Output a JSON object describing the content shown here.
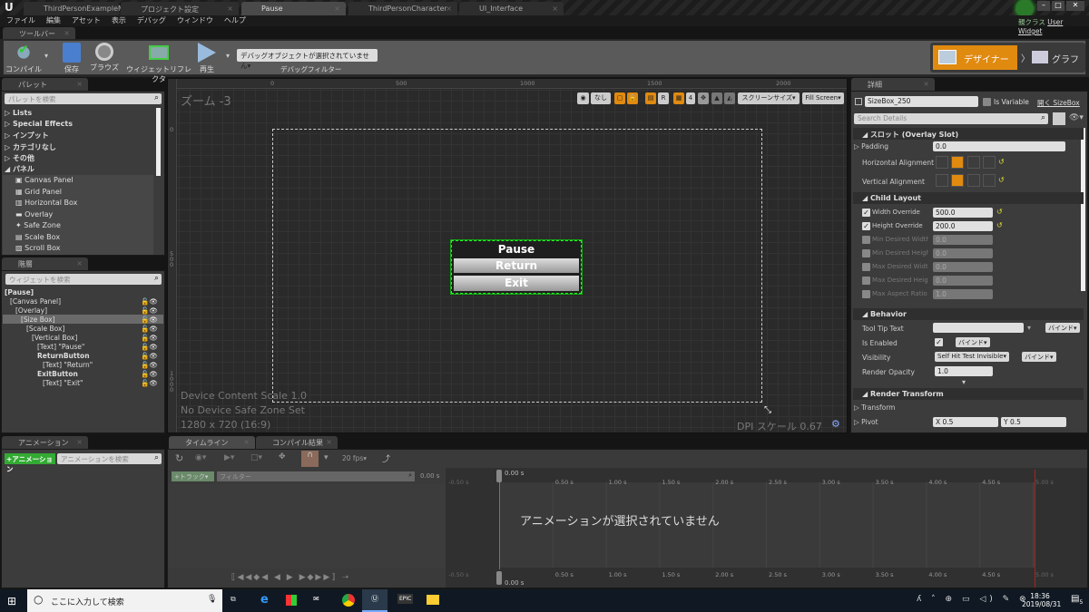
{
  "doc_tabs": [
    {
      "label": "ThirdPersonExampleMap",
      "active": false
    },
    {
      "label": "プロジェクト設定",
      "active": false
    },
    {
      "label": "Pause",
      "active": true
    },
    {
      "label": "ThirdPersonCharacter",
      "active": false
    },
    {
      "label": "UI_Interface",
      "active": false
    }
  ],
  "parent_class": {
    "label": "親クラス",
    "value": "User Widget"
  },
  "menu": [
    "ファイル",
    "編集",
    "アセット",
    "表示",
    "デバッグ",
    "ウィンドウ",
    "ヘルプ"
  ],
  "toolbar": {
    "tab": "ツールバー",
    "compile": "コンパイル",
    "save": "保存",
    "browse": "ブラウズ",
    "widget_reflector": "ウィジェットリフレクタ",
    "play": "再生",
    "debug_select": "デバッグオブジェクトが選択されていません▾",
    "debug_filter": "デバッグフィルター",
    "designer": "デザイナー",
    "graph": "グラフ",
    "accent": "#e08a10"
  },
  "palette": {
    "tab": "パレット",
    "search_placeholder": "パレットを検索",
    "categories": [
      {
        "label": "Lists",
        "open": false
      },
      {
        "label": "Special Effects",
        "open": false
      },
      {
        "label": "インプット",
        "open": false
      },
      {
        "label": "カテゴリなし",
        "open": false
      },
      {
        "label": "その他",
        "open": false
      },
      {
        "label": "パネル",
        "open": true
      }
    ],
    "items": [
      "Canvas Panel",
      "Grid Panel",
      "Horizontal Box",
      "Overlay",
      "Safe Zone",
      "Scale Box",
      "Scroll Box"
    ]
  },
  "hierarchy": {
    "tab": "階層",
    "search_placeholder": "ウィジェットを検索",
    "nodes": [
      {
        "label": "[Pause]",
        "depth": 0,
        "bold": true,
        "selected": false
      },
      {
        "label": "[Canvas Panel]",
        "depth": 1,
        "bold": false,
        "selected": false
      },
      {
        "label": "[Overlay]",
        "depth": 2,
        "bold": false,
        "selected": false
      },
      {
        "label": "[Size Box]",
        "depth": 3,
        "bold": false,
        "selected": true
      },
      {
        "label": "[Scale Box]",
        "depth": 4,
        "bold": false,
        "selected": false
      },
      {
        "label": "[Vertical Box]",
        "depth": 5,
        "bold": false,
        "selected": false
      },
      {
        "label": "[Text] \"Pause\"",
        "depth": 6,
        "bold": false,
        "selected": false
      },
      {
        "label": "ReturnButton",
        "depth": 6,
        "bold": true,
        "selected": false
      },
      {
        "label": "[Text] \"Return\"",
        "depth": 7,
        "bold": false,
        "selected": false
      },
      {
        "label": "ExitButton",
        "depth": 6,
        "bold": true,
        "selected": false
      },
      {
        "label": "[Text] \"Exit\"",
        "depth": 7,
        "bold": false,
        "selected": false
      }
    ]
  },
  "designer": {
    "zoom": "ズーム -3",
    "ruler_top": [
      "0",
      "500",
      "1000",
      "1500",
      "2000"
    ],
    "ruler_left": [
      "0",
      "500",
      "1000"
    ],
    "toolbar": {
      "none": "なし",
      "r": "R",
      "grid": "4",
      "screen_size": "スクリーンサイズ▾",
      "fill": "Fill Screen▾"
    },
    "widget": {
      "title": "Pause",
      "return": "Return",
      "exit": "Exit"
    },
    "info": [
      "Device Content Scale 1.0",
      "No Device Safe Zone Set",
      "1280 x 720 (16:9)"
    ],
    "dpi": "DPI スケール 0.67"
  },
  "details": {
    "tab": "詳細",
    "name": "SizeBox_250",
    "is_variable": "Is Variable",
    "open": "開く SizeBox",
    "search_placeholder": "Search Details",
    "slot_section": "スロット (Overlay Slot)",
    "padding": {
      "label": "Padding",
      "value": "0.0"
    },
    "h_align": {
      "label": "Horizontal Alignment",
      "selected": 1
    },
    "v_align": {
      "label": "Vertical Alignment",
      "selected": 1
    },
    "child_section": "Child Layout",
    "child": [
      {
        "label": "Width Override",
        "value": "500.0",
        "checked": true
      },
      {
        "label": "Height Override",
        "value": "200.0",
        "checked": true
      },
      {
        "label": "Min Desired Width",
        "value": "0.0",
        "checked": false
      },
      {
        "label": "Min Desired Height",
        "value": "0.0",
        "checked": false
      },
      {
        "label": "Max Desired Width",
        "value": "0.0",
        "checked": false
      },
      {
        "label": "Max Desired Height",
        "value": "0.0",
        "checked": false
      },
      {
        "label": "Max Aspect Ratio",
        "value": "1.0",
        "checked": false
      }
    ],
    "behavior_section": "Behavior",
    "tooltip": {
      "label": "Tool Tip Text",
      "value": ""
    },
    "enabled": {
      "label": "Is Enabled",
      "checked": true
    },
    "visibility": {
      "label": "Visibility",
      "value": "Self Hit Test Invisible▾"
    },
    "opacity": {
      "label": "Render Opacity",
      "value": "1.0"
    },
    "bind": "バインド▾",
    "transform_section": "Render Transform",
    "transform": "Transform",
    "pivot": {
      "label": "Pivot",
      "x": "X  0.5",
      "y": "Y  0.5"
    }
  },
  "animation": {
    "tab": "アニメーション",
    "add": "+アニメーション",
    "search_placeholder": "アニメーションを検索"
  },
  "timeline": {
    "tab": "タイムライン",
    "compile_tab": "コンパイル結果",
    "fps": "20 fps▾",
    "track": "+トラック▾",
    "filter_placeholder": "フィルター",
    "time": "0.00 s",
    "cursor": "0.00 s",
    "ticks": [
      "-0.50 s",
      "0.50 s",
      "1.00 s",
      "1.50 s",
      "2.00 s",
      "2.50 s",
      "3.00 s",
      "3.50 s",
      "4.00 s",
      "4.50 s",
      "5.00 s"
    ],
    "empty": "アニメーションが選択されていません"
  },
  "taskbar": {
    "search": "ここに入力して検索",
    "time": "18:36",
    "date": "2019/08/31",
    "notif": "5"
  }
}
